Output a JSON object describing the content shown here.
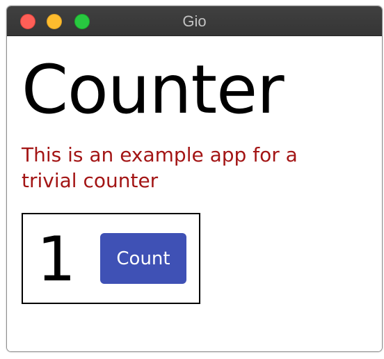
{
  "window": {
    "title": "Gio",
    "controls": {
      "close_color": "#fe5f57",
      "minimize_color": "#febc2e",
      "zoom_color": "#28c840"
    }
  },
  "app": {
    "title": "Counter",
    "description": "This is an example app for a trivial counter",
    "description_color": "#a31515",
    "counter": {
      "value": "1",
      "button_label": "Count",
      "button_color": "#3f51b5"
    }
  }
}
